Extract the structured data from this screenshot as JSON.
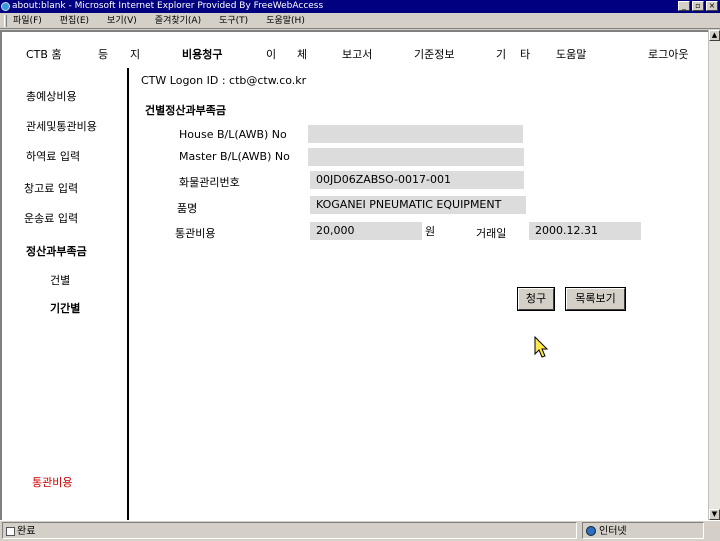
{
  "window": {
    "title": "about:blank - Microsoft Internet Explorer Provided By FreeWebAccess"
  },
  "menubar": {
    "items": [
      "파일(F)",
      "편집(E)",
      "보기(V)",
      "즐겨찾기(A)",
      "도구(T)",
      "도움말(H)"
    ]
  },
  "topnav": {
    "home": "CTB 홈",
    "register_1": "등",
    "register_2": "지",
    "billing": "비용청구",
    "transfer_1": "이",
    "transfer_2": "체",
    "report": "보고서",
    "base_info": "기준정보",
    "etc_1": "기",
    "etc_2": "타",
    "help": "도움말",
    "logout": "로그아웃"
  },
  "sidebar": {
    "items": [
      "총예상비용",
      "관세및통관비용",
      "하역료 입력",
      "창고료 입력",
      "운송료 입력",
      "정산과부족금",
      "건별",
      "기간별"
    ],
    "footer": "통관비용"
  },
  "main": {
    "logon_id": "CTW Logon ID : ctb@ctw.co.kr",
    "section_title": "건별정산과부족금",
    "house_bl_label": "House B/L(AWB) No",
    "house_bl_value": "",
    "master_bl_label": "Master B/L(AWB) No",
    "master_bl_value": "",
    "cargo_no_label": "화물관리번호",
    "cargo_no_value": "00JD06ZABSO-0017-001",
    "item_label": "품명",
    "item_value": "KOGANEI PNEUMATIC EQUIPMENT",
    "clearance_cost_label": "통관비용",
    "clearance_cost_value": "20,000",
    "currency_unit": "원",
    "trade_date_label": "거래일",
    "trade_date_value": "2000.12.31",
    "claim_button": "청구",
    "list_button": "목록보기"
  },
  "statusbar": {
    "left": "완료",
    "zone": "인터넷"
  }
}
